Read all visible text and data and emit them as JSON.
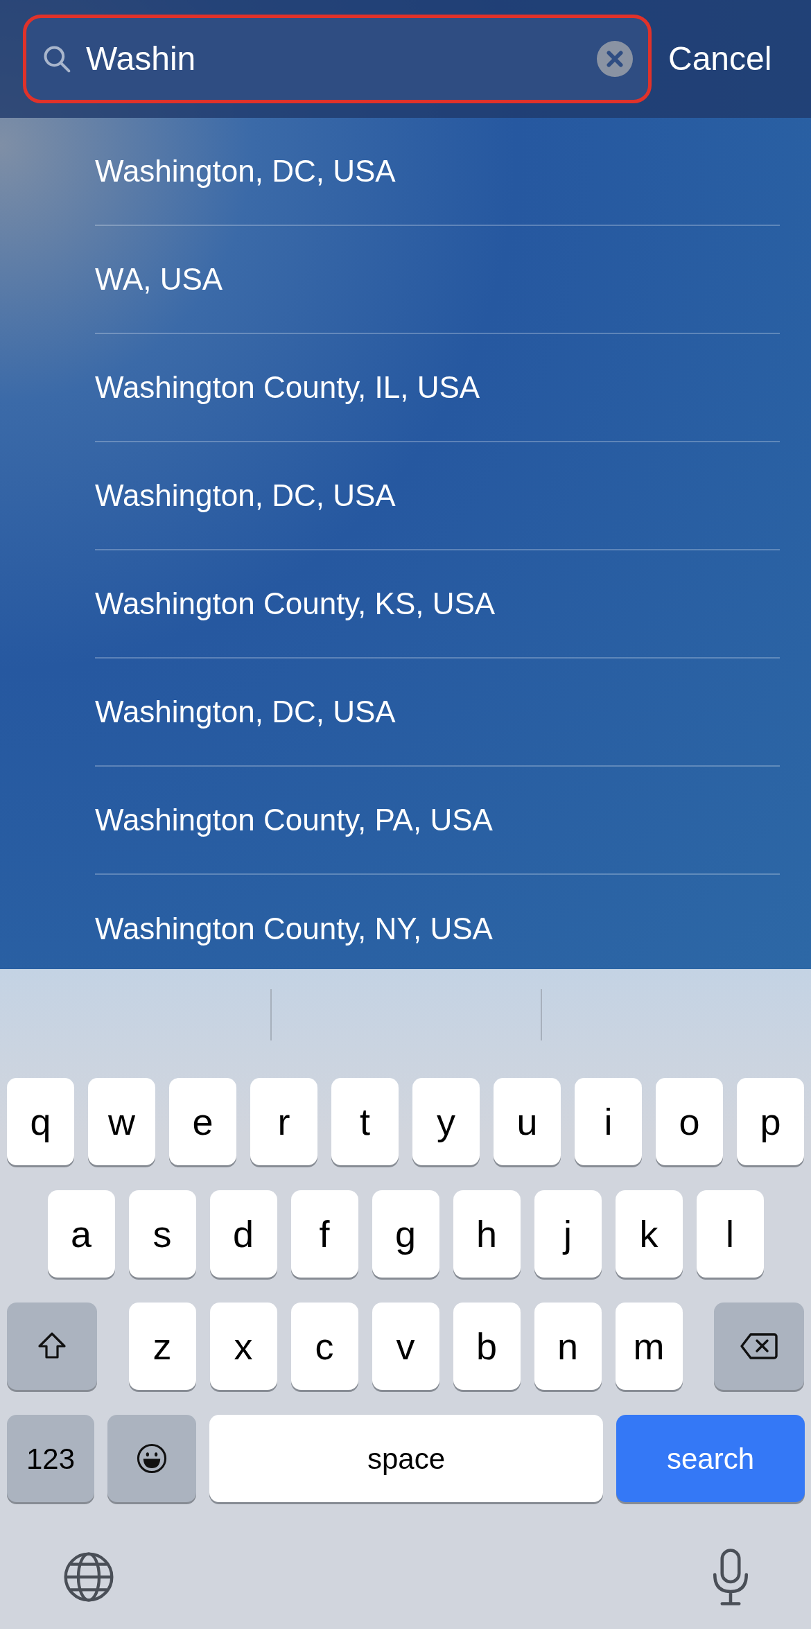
{
  "search": {
    "value": "Washin",
    "outlined": true
  },
  "cancel": "Cancel",
  "results": [
    {
      "label": "Washington, DC, USA"
    },
    {
      "label": "WA, USA"
    },
    {
      "label": "Washington County, IL, USA"
    },
    {
      "label": "Washington, DC, USA"
    },
    {
      "label": "Washington County, KS, USA"
    },
    {
      "label": "Washington, DC, USA"
    },
    {
      "label": "Washington County, PA, USA"
    },
    {
      "label": "Washington County, NY, USA"
    }
  ],
  "keyboard": {
    "top_row": [
      {
        "kind": "letter",
        "label": "q"
      },
      {
        "kind": "letter",
        "label": "w"
      },
      {
        "kind": "letter",
        "label": "e"
      },
      {
        "kind": "letter",
        "label": "r"
      },
      {
        "kind": "letter",
        "label": "t"
      },
      {
        "kind": "letter",
        "label": "y"
      },
      {
        "kind": "letter",
        "label": "u"
      },
      {
        "kind": "letter",
        "label": "i"
      },
      {
        "kind": "letter",
        "label": "o"
      },
      {
        "kind": "letter",
        "label": "p"
      }
    ],
    "middle_row": [
      {
        "kind": "letter",
        "label": "a"
      },
      {
        "kind": "letter",
        "label": "s"
      },
      {
        "kind": "letter",
        "label": "d"
      },
      {
        "kind": "letter",
        "label": "f"
      },
      {
        "kind": "letter",
        "label": "g"
      },
      {
        "kind": "letter",
        "label": "h"
      },
      {
        "kind": "letter",
        "label": "j"
      },
      {
        "kind": "letter",
        "label": "k"
      },
      {
        "kind": "letter",
        "label": "l"
      }
    ],
    "bottom_row": [
      {
        "kind": "shift"
      },
      {
        "kind": "letter",
        "label": "z"
      },
      {
        "kind": "letter",
        "label": "x"
      },
      {
        "kind": "letter",
        "label": "c"
      },
      {
        "kind": "letter",
        "label": "v"
      },
      {
        "kind": "letter",
        "label": "b"
      },
      {
        "kind": "letter",
        "label": "n"
      },
      {
        "kind": "letter",
        "label": "m"
      },
      {
        "kind": "delete"
      }
    ],
    "function_row": [
      {
        "kind": "mode",
        "label": "123"
      },
      {
        "kind": "emoji"
      },
      {
        "kind": "space",
        "label": "space"
      },
      {
        "kind": "return",
        "label": "search"
      }
    ]
  }
}
